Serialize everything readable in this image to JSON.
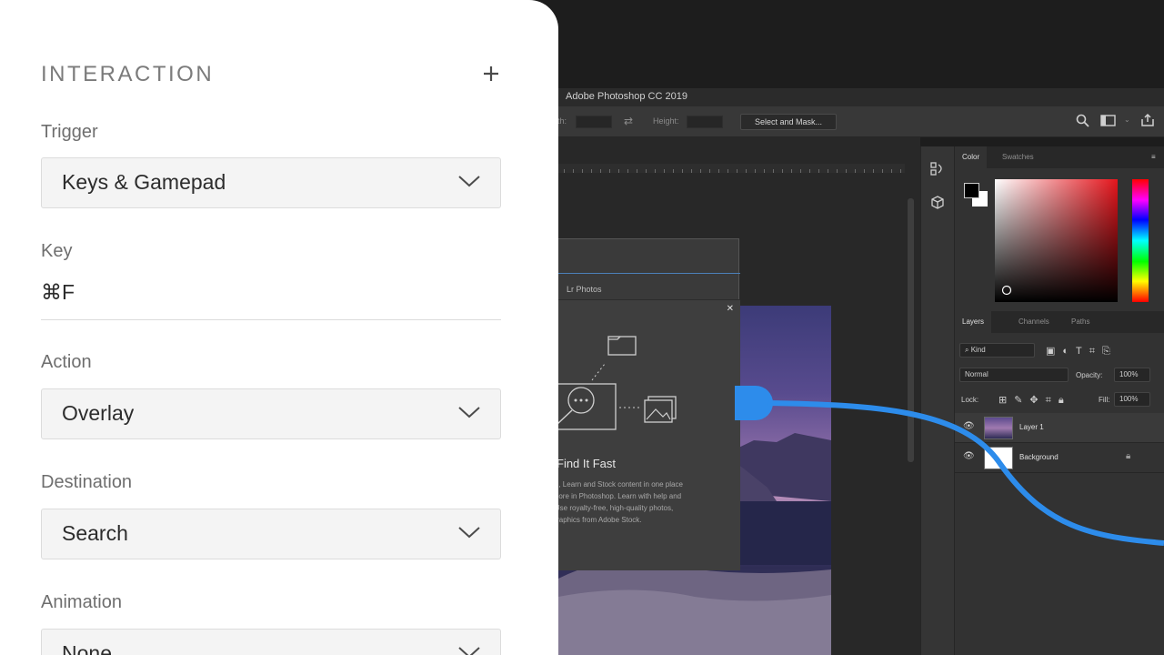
{
  "photoshop": {
    "window_title": "Adobe Photoshop CC 2019",
    "options": {
      "width_label": "dth:",
      "height_label": "Height:",
      "select_mask_label": "Select and Mask..."
    },
    "color_tabs": [
      "Color",
      "Swatches"
    ],
    "layers_tabs": [
      "Layers",
      "Channels",
      "Paths"
    ],
    "kind_filter": "Kind",
    "blend_mode": "Normal",
    "opacity_label": "Opacity:",
    "opacity_value": "100%",
    "lock_label": "Lock:",
    "fill_label": "Fill:",
    "fill_value": "100%",
    "layers": [
      {
        "name": "Layer 1"
      },
      {
        "name": "Background"
      }
    ],
    "dialog": {
      "tab_label": "Lr Photos",
      "heading": "Find It Fast",
      "body_lines": [
        "hop, Learn and Stock content in one place",
        "d more in Photoshop. Learn with help and",
        "h. Use royalty-free, high-quality photos,",
        "d graphics from Adobe Stock."
      ]
    }
  },
  "interaction_panel": {
    "title": "INTERACTION",
    "add_symbol": "+",
    "trigger": {
      "label": "Trigger",
      "value": "Keys & Gamepad"
    },
    "key": {
      "label": "Key",
      "value": "⌘F"
    },
    "action": {
      "label": "Action",
      "value": "Overlay"
    },
    "destination": {
      "label": "Destination",
      "value": "Search"
    },
    "animation": {
      "label": "Animation",
      "value": "None"
    }
  },
  "colors": {
    "accent_blue": "#2d8ceb",
    "panel_bg": "#ffffff",
    "ps_bg": "#1d1d1d"
  }
}
